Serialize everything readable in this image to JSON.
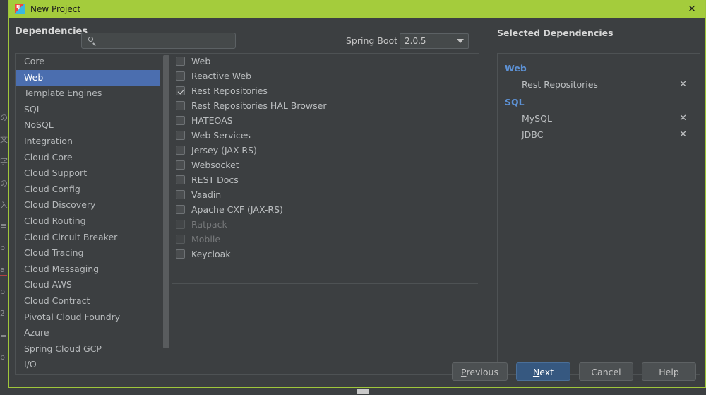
{
  "window": {
    "title": "New Project",
    "icon": "intellij-idea-icon",
    "close_label": "✕",
    "accent_color": "#a4cc3c"
  },
  "header": {
    "dependencies_label": "Dependencies",
    "search": {
      "icon": "search-icon",
      "value": "",
      "placeholder": ""
    },
    "spring_boot_label": "Spring Boot",
    "version": {
      "selected": "2.0.5",
      "caret_icon": "chevron-down-icon"
    },
    "selected_dependencies_title": "Selected Dependencies"
  },
  "categories": {
    "selected": "Web",
    "items": [
      {
        "label": "Core",
        "selected": false
      },
      {
        "label": "Web",
        "selected": true
      },
      {
        "label": "Template Engines",
        "selected": false
      },
      {
        "label": "SQL",
        "selected": false
      },
      {
        "label": "NoSQL",
        "selected": false
      },
      {
        "label": "Integration",
        "selected": false
      },
      {
        "label": "Cloud Core",
        "selected": false
      },
      {
        "label": "Cloud Support",
        "selected": false
      },
      {
        "label": "Cloud Config",
        "selected": false
      },
      {
        "label": "Cloud Discovery",
        "selected": false
      },
      {
        "label": "Cloud Routing",
        "selected": false
      },
      {
        "label": "Cloud Circuit Breaker",
        "selected": false
      },
      {
        "label": "Cloud Tracing",
        "selected": false
      },
      {
        "label": "Cloud Messaging",
        "selected": false
      },
      {
        "label": "Cloud AWS",
        "selected": false
      },
      {
        "label": "Cloud Contract",
        "selected": false
      },
      {
        "label": "Pivotal Cloud Foundry",
        "selected": false
      },
      {
        "label": "Azure",
        "selected": false
      },
      {
        "label": "Spring Cloud GCP",
        "selected": false
      },
      {
        "label": "I/O",
        "selected": false
      }
    ]
  },
  "dependency_checkboxes": [
    {
      "label": "Web",
      "checked": false,
      "disabled": false
    },
    {
      "label": "Reactive Web",
      "checked": false,
      "disabled": false
    },
    {
      "label": "Rest Repositories",
      "checked": true,
      "disabled": false
    },
    {
      "label": "Rest Repositories HAL Browser",
      "checked": false,
      "disabled": false
    },
    {
      "label": "HATEOAS",
      "checked": false,
      "disabled": false
    },
    {
      "label": "Web Services",
      "checked": false,
      "disabled": false
    },
    {
      "label": "Jersey (JAX-RS)",
      "checked": false,
      "disabled": false
    },
    {
      "label": "Websocket",
      "checked": false,
      "disabled": false
    },
    {
      "label": "REST Docs",
      "checked": false,
      "disabled": false
    },
    {
      "label": "Vaadin",
      "checked": false,
      "disabled": false
    },
    {
      "label": "Apache CXF (JAX-RS)",
      "checked": false,
      "disabled": false
    },
    {
      "label": "Ratpack",
      "checked": false,
      "disabled": true
    },
    {
      "label": "Mobile",
      "checked": false,
      "disabled": true
    },
    {
      "label": "Keycloak",
      "checked": false,
      "disabled": false
    }
  ],
  "selected_dependencies": [
    {
      "group": "Web",
      "items": [
        {
          "label": "Rest Repositories",
          "remove_icon": "✕"
        }
      ]
    },
    {
      "group": "SQL",
      "items": [
        {
          "label": "MySQL",
          "remove_icon": "✕"
        },
        {
          "label": "JDBC",
          "remove_icon": "✕"
        }
      ]
    }
  ],
  "footer": {
    "buttons": [
      {
        "label": "Previous",
        "mnemonic": "P",
        "primary": false
      },
      {
        "label": "Next",
        "mnemonic": "N",
        "primary": true
      },
      {
        "label": "Cancel",
        "mnemonic": "",
        "primary": false
      },
      {
        "label": "Help",
        "mnemonic": "",
        "primary": false
      }
    ]
  },
  "background": {
    "fragments": [
      "の",
      "文",
      "字",
      "の",
      "入",
      "≡",
      "p",
      "a",
      "p",
      "2",
      "≡",
      "p"
    ]
  }
}
